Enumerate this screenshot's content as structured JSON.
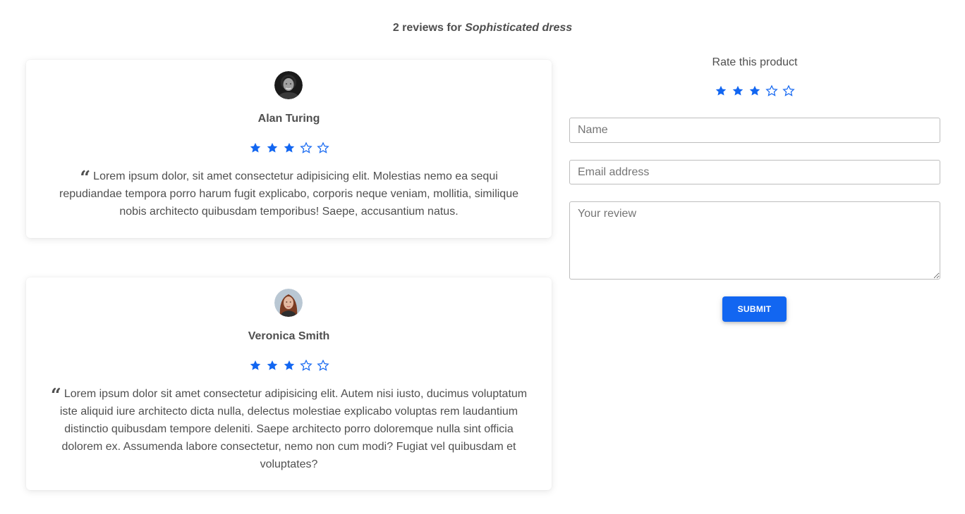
{
  "header": {
    "prefix": "2 reviews for ",
    "product_name": "Sophisticated dress"
  },
  "colors": {
    "accent": "#1266f1",
    "text": "#4f4f4f",
    "card_background": "#ffffff"
  },
  "reviews": [
    {
      "name": "Alan Turing",
      "rating": 3,
      "max_rating": 5,
      "avatar_icon": "avatar-man-photo",
      "text": "Lorem ipsum dolor, sit amet consectetur adipisicing elit. Molestias nemo ea sequi repudiandae tempora porro harum fugit explicabo, corporis neque veniam, mollitia, similique nobis architecto quibusdam temporibus! Saepe, accusantium natus."
    },
    {
      "name": "Veronica Smith",
      "rating": 3,
      "max_rating": 5,
      "avatar_icon": "avatar-woman-photo",
      "text": "Lorem ipsum dolor sit amet consectetur adipisicing elit. Autem nisi iusto, ducimus voluptatum iste aliquid iure architecto dicta nulla, delectus molestiae explicabo voluptas rem laudantium distinctio quibusdam tempore deleniti. Saepe architecto porro doloremque nulla sint officia dolorem ex. Assumenda labore consectetur, nemo non cum modi? Fugiat vel quibusdam et voluptates?"
    }
  ],
  "rate_form": {
    "title": "Rate this product",
    "rating": 3,
    "max_rating": 5,
    "name_placeholder": "Name",
    "email_placeholder": "Email address",
    "review_placeholder": "Your review",
    "submit_label": "SUBMIT"
  }
}
